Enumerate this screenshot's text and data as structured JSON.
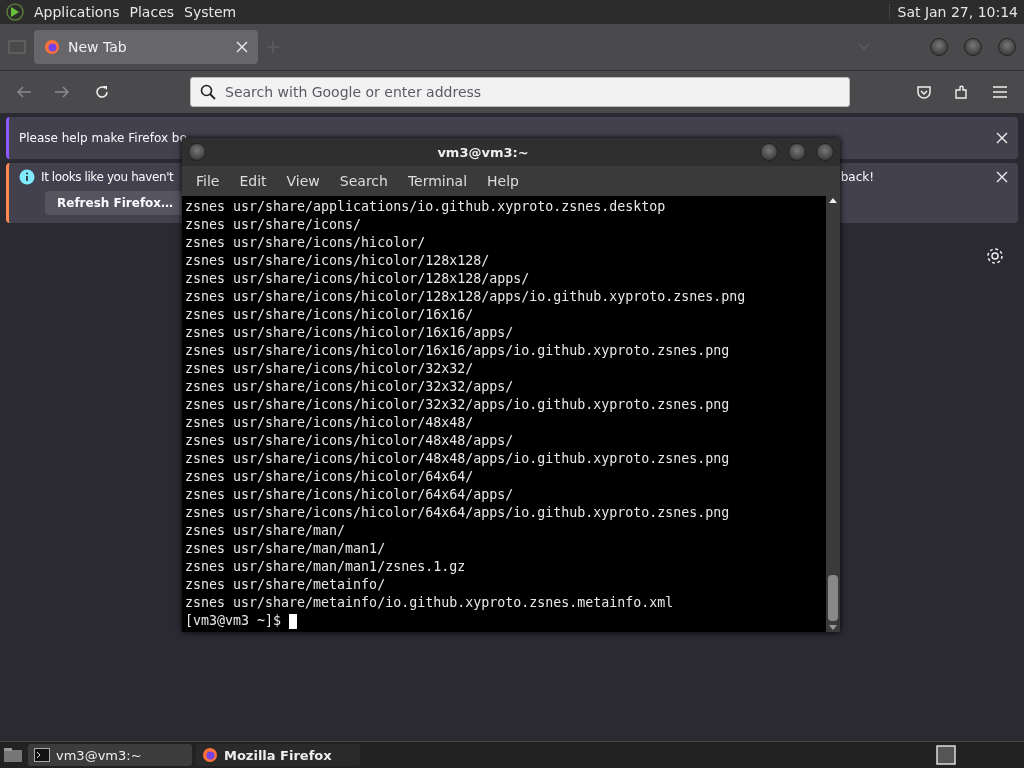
{
  "top_panel": {
    "menus": [
      "Applications",
      "Places",
      "System"
    ],
    "clock": "Sat Jan 27, 10:14"
  },
  "browser": {
    "tabs": [
      {
        "label": "New Tab",
        "selected": true
      }
    ],
    "address_bar": {
      "placeholder": "Search with Google or enter address"
    },
    "notifications": [
      {
        "kind": "survey",
        "text": "Please help make Firefox be"
      },
      {
        "kind": "info",
        "text": "It looks like you haven't",
        "tail": "back!",
        "button": "Refresh Firefox…"
      }
    ]
  },
  "terminal": {
    "title": "vm3@vm3:~",
    "menus": [
      "File",
      "Edit",
      "View",
      "Search",
      "Terminal",
      "Help"
    ],
    "lines": [
      "zsnes usr/share/applications/io.github.xyproto.zsnes.desktop",
      "zsnes usr/share/icons/",
      "zsnes usr/share/icons/hicolor/",
      "zsnes usr/share/icons/hicolor/128x128/",
      "zsnes usr/share/icons/hicolor/128x128/apps/",
      "zsnes usr/share/icons/hicolor/128x128/apps/io.github.xyproto.zsnes.png",
      "zsnes usr/share/icons/hicolor/16x16/",
      "zsnes usr/share/icons/hicolor/16x16/apps/",
      "zsnes usr/share/icons/hicolor/16x16/apps/io.github.xyproto.zsnes.png",
      "zsnes usr/share/icons/hicolor/32x32/",
      "zsnes usr/share/icons/hicolor/32x32/apps/",
      "zsnes usr/share/icons/hicolor/32x32/apps/io.github.xyproto.zsnes.png",
      "zsnes usr/share/icons/hicolor/48x48/",
      "zsnes usr/share/icons/hicolor/48x48/apps/",
      "zsnes usr/share/icons/hicolor/48x48/apps/io.github.xyproto.zsnes.png",
      "zsnes usr/share/icons/hicolor/64x64/",
      "zsnes usr/share/icons/hicolor/64x64/apps/",
      "zsnes usr/share/icons/hicolor/64x64/apps/io.github.xyproto.zsnes.png",
      "zsnes usr/share/man/",
      "zsnes usr/share/man/man1/",
      "zsnes usr/share/man/man1/zsnes.1.gz",
      "zsnes usr/share/metainfo/",
      "zsnes usr/share/metainfo/io.github.xyproto.zsnes.metainfo.xml"
    ],
    "prompt": "[vm3@vm3 ~]$"
  },
  "taskbar": {
    "items": [
      {
        "kind": "terminal",
        "label": "vm3@vm3:~",
        "selected": false
      },
      {
        "kind": "browser",
        "label": "Mozilla Firefox",
        "selected": true
      }
    ]
  }
}
